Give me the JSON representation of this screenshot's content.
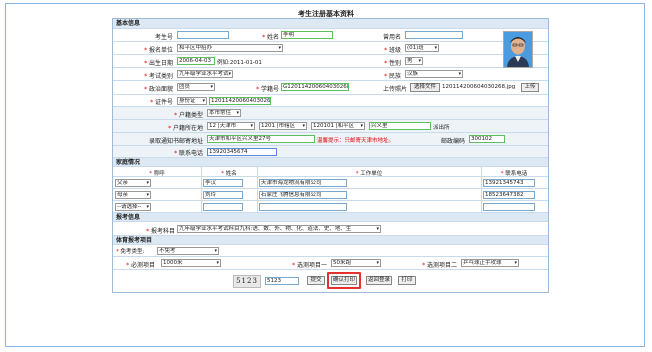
{
  "page_title": "考生注册基本资料",
  "sections": {
    "basic": "基本信息",
    "family": "家庭情况",
    "subject": "报考信息",
    "sport": "体育报考项目"
  },
  "fields": {
    "exam_no_label": "考生号",
    "exam_no": "",
    "name_label": "姓名",
    "name": "李明",
    "used_name_label": "曾用名",
    "used_name": "",
    "unit_label": "报名单位",
    "unit": "和平区中招办",
    "class_label": "班级",
    "class": "(01)班",
    "birth_label": "出生日期",
    "birth": "2006-04-03",
    "birth_hint": "例如:2011-01-01",
    "gender_label": "性别",
    "gender": "男",
    "exam_type_label": "考试类别",
    "exam_type": "九年级学业水平考试",
    "nation_label": "民族",
    "nation": "汉族",
    "politics_label": "政治面貌",
    "politics": "团员",
    "student_no_label": "学籍号",
    "student_no": "G120114200604030268",
    "upload_label": "上传照片",
    "choose_file": "选择文件",
    "file_name": "120114200604030268.jpg",
    "upload_btn": "上传",
    "id_label": "证件号",
    "id_type": "身份证",
    "id_no": "120114200604030268",
    "hukou_type_label": "户籍类型",
    "hukou_type": "本市常住",
    "hukou_place_label": "户籍所在地",
    "hukou_p1": "12 |天津市",
    "hukou_p2": "1201 |市辖区",
    "hukou_p3": "120101 |和平区",
    "hukou_p4": "兴义里",
    "hukou_suffix": "派出所",
    "mail_addr_label": "录取通知书邮寄地址",
    "mail_addr": "天津市和平区兴义里27号",
    "mail_warn": "温馨提示：只邮寄天津市地址。",
    "postcode_label": "邮政编码",
    "postcode": "300102",
    "phone_label": "联系电话",
    "phone": "13920345674"
  },
  "family": {
    "headers": [
      "称呼",
      "姓名",
      "工作单位",
      "联系电话"
    ],
    "rows": [
      {
        "relation": "父亲",
        "name": "李汉",
        "work": "天津市海龙物流有限公司",
        "phone": "13921345743"
      },
      {
        "relation": "母亲",
        "name": "刘玲",
        "work": "石家庄飞腾信息有限公司",
        "phone": "18523647382"
      },
      {
        "relation": "--请选择--",
        "name": "",
        "work": "",
        "phone": ""
      }
    ]
  },
  "subject": {
    "label": "报考科目",
    "value": "九年级学业水平考试科目九科:语、数、外、物、化、道法、史、地、生"
  },
  "sport": {
    "exempt_label": "免考类型:",
    "exempt": "不免考",
    "required_label": "必测项目",
    "required": "1000米",
    "opt1_label": "选测项目一",
    "opt1": "50米跑",
    "opt2_label": "选测项目二",
    "opt2": "乒乓球正手攻球"
  },
  "footer": {
    "captcha_img": "5123",
    "captcha_value": "5123",
    "submit": "提交",
    "confirm_print": "确认打印",
    "back_login": "返回登录",
    "print": "打印"
  },
  "colors": {
    "highlight_box": "#e53030",
    "section_bg": "#dce8f4",
    "required_star": "#e00000"
  }
}
